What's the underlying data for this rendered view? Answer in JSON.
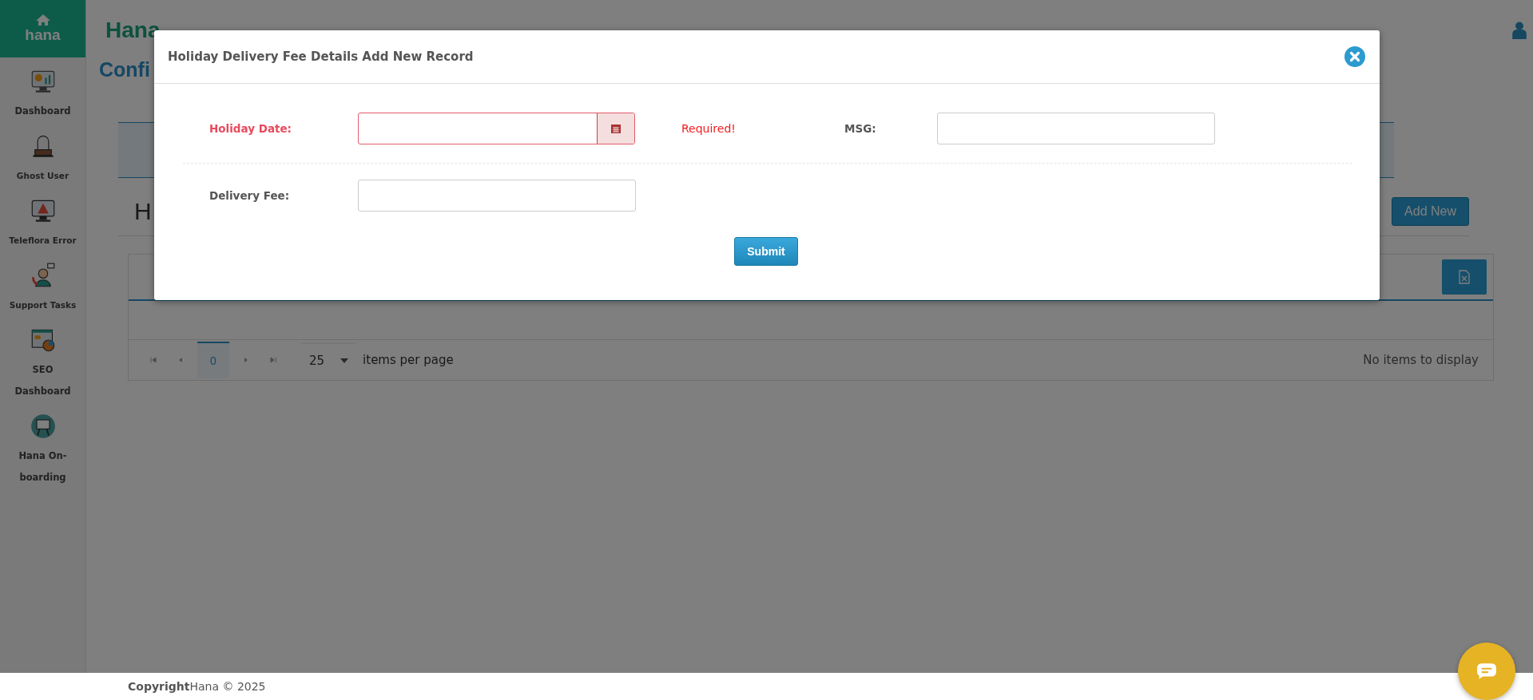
{
  "sidebar": {
    "logo": {
      "label": "hana"
    },
    "items": [
      {
        "label": "Dashboard"
      },
      {
        "label": "Ghost User"
      },
      {
        "label": "Teleflora Error"
      },
      {
        "label": "Support Tasks"
      },
      {
        "label": "SEO Dashboard"
      },
      {
        "label": "Hana On-boarding"
      }
    ]
  },
  "header": {
    "title": "Hana"
  },
  "page": {
    "title": "Confi",
    "section_heading": "H",
    "add_button": "Add New",
    "pager": {
      "pages": [
        {
          "label": "0",
          "selected": true
        }
      ],
      "page_size": "25",
      "page_size_label": "items per page",
      "status": "No items to display"
    }
  },
  "modal": {
    "title": "Holiday Delivery Fee Details Add New Record",
    "rows": [
      {
        "fields": [
          {
            "label": "Holiday Date:",
            "kind": "date",
            "invalid": true,
            "error": "Required!"
          },
          {
            "label": "MSG:",
            "kind": "text",
            "invalid": false
          }
        ]
      },
      {
        "fields": [
          {
            "label": "Delivery Fee:",
            "kind": "text",
            "invalid": false
          }
        ]
      }
    ],
    "submit": "Submit"
  },
  "footer": {
    "copyright_label": "Copyright",
    "copyright_text": "Hana © 2025"
  }
}
